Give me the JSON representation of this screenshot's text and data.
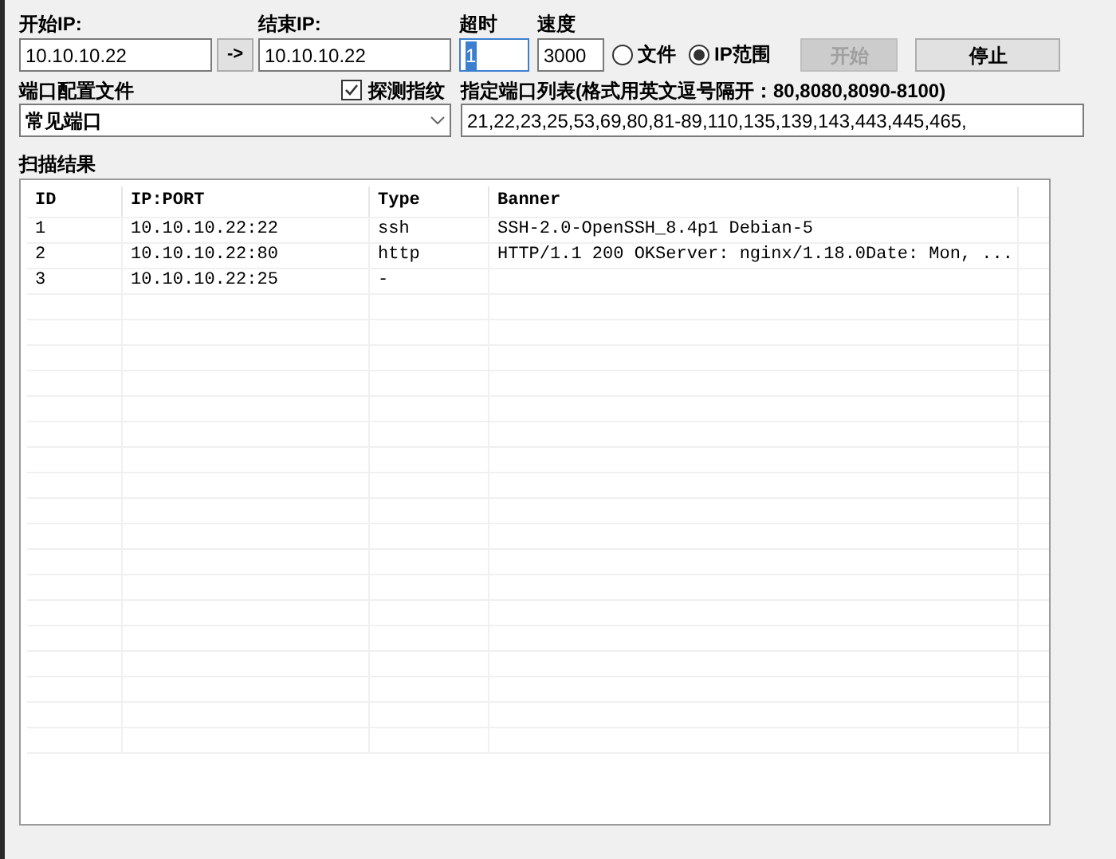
{
  "start_ip": {
    "label": "开始IP:",
    "value": "10.10.10.22"
  },
  "range_button": "->",
  "end_ip": {
    "label": "结束IP:",
    "value": "10.10.10.22"
  },
  "timeout": {
    "label": "超时",
    "value": "1"
  },
  "speed": {
    "label": "速度",
    "value": "3000"
  },
  "source_options": [
    {
      "label": "文件",
      "selected": false
    },
    {
      "label": "IP范围",
      "selected": true
    }
  ],
  "buttons": [
    {
      "label": "开始",
      "disabled": true
    },
    {
      "label": "停止",
      "disabled": false
    }
  ],
  "port_profile": {
    "label": "端口配置文件",
    "value": "常见端口"
  },
  "fingerprint": {
    "label": "探测指纹",
    "checked": true
  },
  "port_list": {
    "label": "指定端口列表(格式用英文逗号隔开：80,8080,8090-8100)",
    "value": "21,22,23,25,53,69,80,81-89,110,135,139,143,443,445,465,"
  },
  "results": {
    "title": "扫描结果",
    "columns": [
      "ID",
      "IP:PORT",
      "Type",
      "Banner"
    ],
    "rows": [
      [
        "1",
        "10.10.10.22:22",
        "ssh",
        "SSH-2.0-OpenSSH_8.4p1 Debian-5"
      ],
      [
        "2",
        "10.10.10.22:80",
        "http",
        "HTTP/1.1 200 OKServer: nginx/1.18.0Date: Mon, ..."
      ],
      [
        "3",
        "10.10.10.22:25",
        "-",
        ""
      ]
    ]
  }
}
